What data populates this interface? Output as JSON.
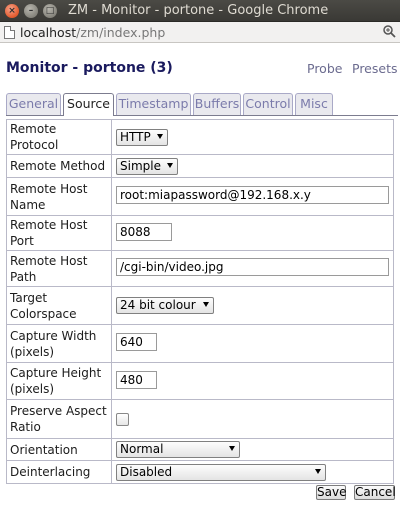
{
  "window": {
    "title": "ZM - Monitor - portone - Google Chrome",
    "controls": {
      "close": "×",
      "minimize": "–",
      "maximize": "□"
    }
  },
  "address_bar": {
    "host": "localhost",
    "path": "/zm/index.php"
  },
  "header": {
    "title": "Monitor - portone (3)",
    "probe_link": "Probe",
    "presets_link": "Presets"
  },
  "tabs": [
    {
      "label": "General",
      "active": false
    },
    {
      "label": "Source",
      "active": true
    },
    {
      "label": "Timestamp",
      "active": false
    },
    {
      "label": "Buffers",
      "active": false
    },
    {
      "label": "Control",
      "active": false
    },
    {
      "label": "Misc",
      "active": false
    }
  ],
  "fields": {
    "remote_protocol": {
      "label": "Remote Protocol",
      "value": "HTTP"
    },
    "remote_method": {
      "label": "Remote Method",
      "value": "Simple"
    },
    "remote_host_name": {
      "label": "Remote Host Name",
      "value": "root:miapassword@192.168.x.y"
    },
    "remote_host_port": {
      "label": "Remote Host Port",
      "value": "8088"
    },
    "remote_host_path": {
      "label": "Remote Host Path",
      "value": "/cgi-bin/video.jpg"
    },
    "target_colorspace": {
      "label": "Target Colorspace",
      "value": "24 bit colour"
    },
    "capture_width": {
      "label": "Capture Width (pixels)",
      "value": "640"
    },
    "capture_height": {
      "label": "Capture Height (pixels)",
      "value": "480"
    },
    "preserve_aspect_ratio": {
      "label": "Preserve Aspect Ratio",
      "checked": false
    },
    "orientation": {
      "label": "Orientation",
      "value": "Normal"
    },
    "deinterlacing": {
      "label": "Deinterlacing",
      "value": "Disabled"
    }
  },
  "buttons": {
    "save": "Save",
    "cancel": "Cancel"
  },
  "icons": {
    "page": "page-icon",
    "zoom": "zoom-icon"
  },
  "colors": {
    "title_color": "#1a1a5e",
    "link_color": "#6b6b8f",
    "tab_inactive_text": "#7b7bab"
  }
}
